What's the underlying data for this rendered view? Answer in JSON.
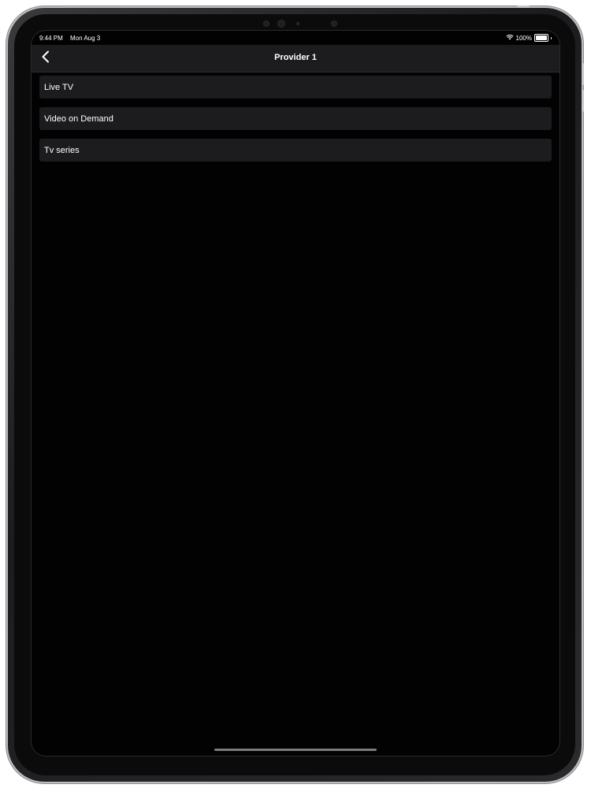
{
  "status_bar": {
    "time": "9:44 PM",
    "date": "Mon Aug 3",
    "battery_percent": "100%",
    "battery_level": 1.0,
    "wifi_icon": "wifi-icon"
  },
  "nav": {
    "back_icon": "chevron-left-icon",
    "title": "Provider 1"
  },
  "menu": {
    "items": [
      {
        "label": "Live TV"
      },
      {
        "label": "Video on Demand"
      },
      {
        "label": "Tv series"
      }
    ]
  },
  "colors": {
    "background": "#020203",
    "cell_background": "#1c1c1e",
    "text": "#ffffff"
  }
}
